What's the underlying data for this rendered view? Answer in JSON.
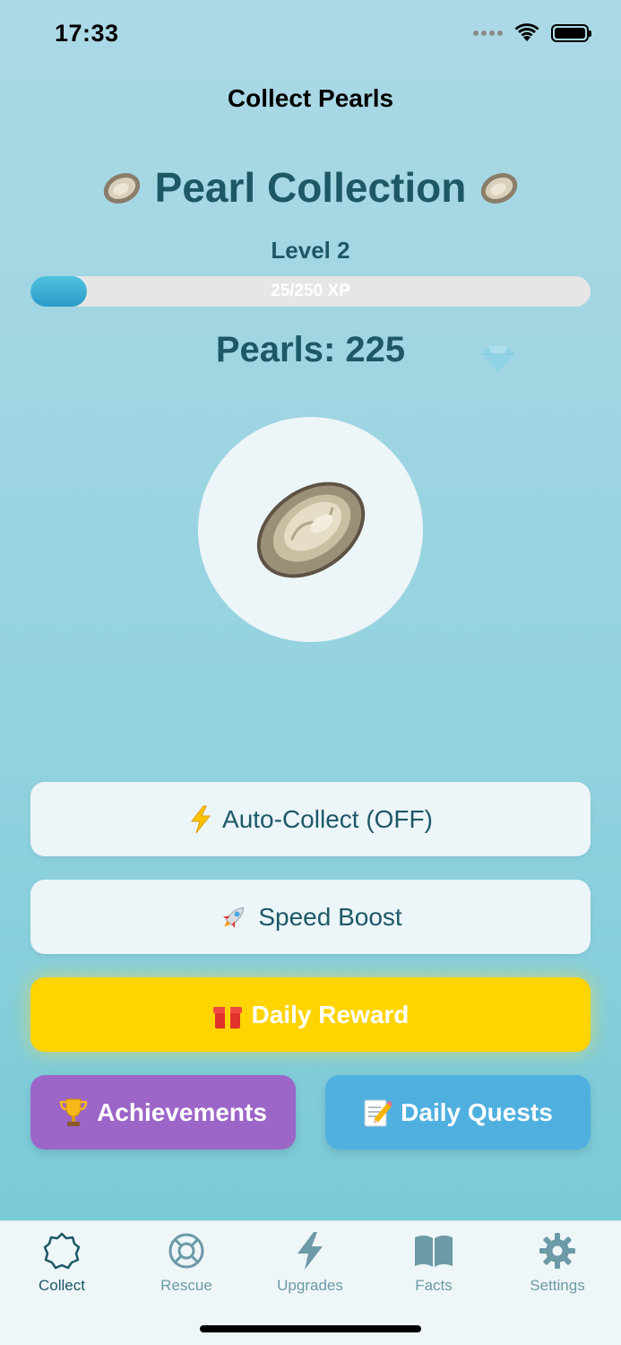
{
  "status_bar": {
    "time": "17:33",
    "icons": [
      "signal-dots-icon",
      "wifi-icon",
      "battery-icon"
    ]
  },
  "nav": {
    "title": "Collect Pearls"
  },
  "game": {
    "heading": "Pearl Collection",
    "heading_icon": "oyster-icon",
    "level": "Level 2",
    "xp_text": "25/250 XP",
    "xp_progress": 0.1,
    "pearls": "Pearls: 225",
    "tap_target_icon": "oyster-icon"
  },
  "actions": {
    "auto_collect": {
      "label": "Auto-Collect (OFF)",
      "icon": "lightning-icon"
    },
    "speed_boost": {
      "label": "Speed Boost",
      "icon": "rocket-icon"
    },
    "daily_reward": {
      "label": "Daily Reward",
      "icon": "gift-icon"
    },
    "achievements": {
      "label": "Achievements",
      "icon": "trophy-icon"
    },
    "daily_quests": {
      "label": "Daily Quests",
      "icon": "memo-icon"
    }
  },
  "tabs": [
    {
      "label": "Collect",
      "icon": "shell-outline-icon",
      "active": true
    },
    {
      "label": "Rescue",
      "icon": "lifebuoy-icon",
      "active": false
    },
    {
      "label": "Upgrades",
      "icon": "bolt-icon",
      "active": false
    },
    {
      "label": "Facts",
      "icon": "book-icon",
      "active": false
    },
    {
      "label": "Settings",
      "icon": "gear-icon",
      "active": false
    }
  ],
  "colors": {
    "accent_text": "#1d5866",
    "daily_reward": "#ffd400",
    "achievements": "#9c66c8",
    "daily_quests": "#4fb0e0",
    "tab_inactive": "#6c9aa6"
  }
}
